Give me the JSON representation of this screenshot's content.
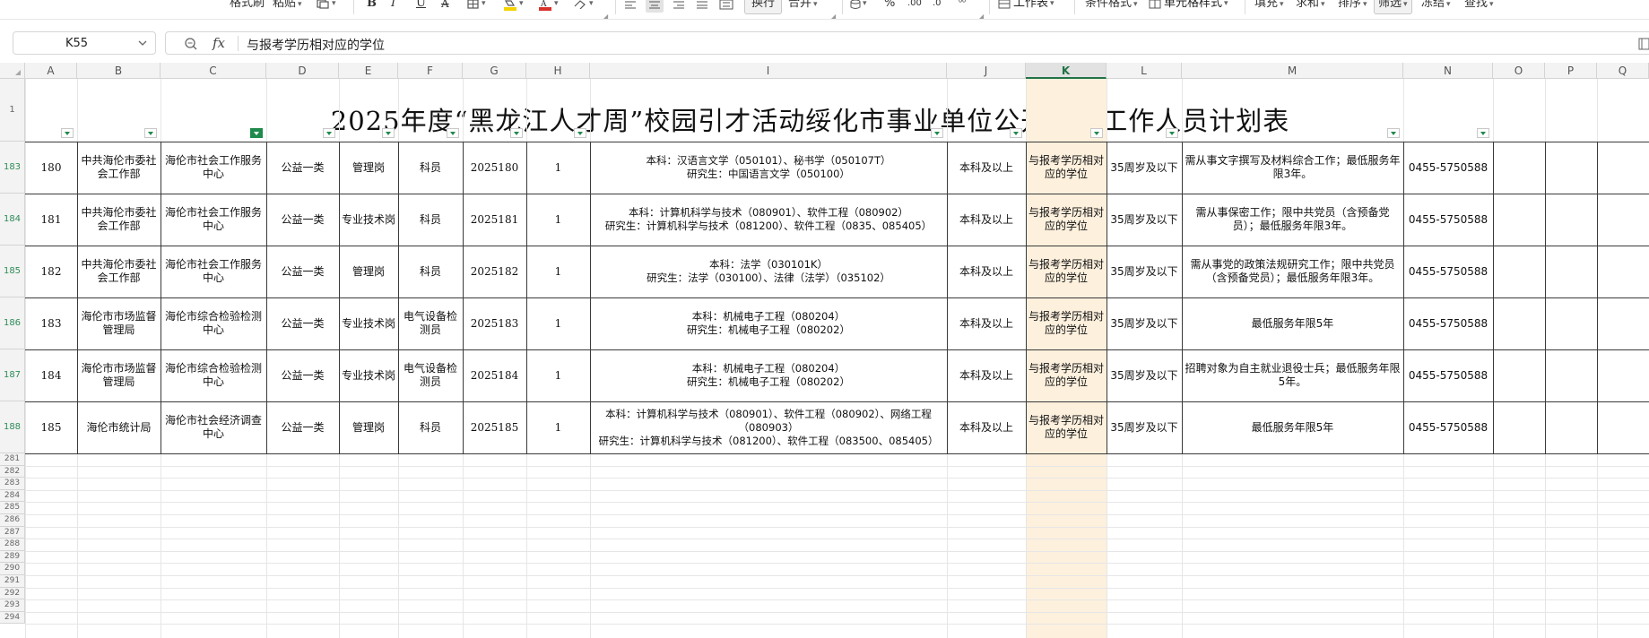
{
  "toolbar": {
    "format_painter": "格式刷",
    "paste": "粘贴",
    "bold": "B",
    "italic": "I",
    "underline": "U",
    "strikethrough": "A",
    "wrap": "换行",
    "merge": "合并",
    "percent": "%",
    "worksheet": "工作表",
    "conditional_format": "条件格式",
    "cell_style": "单元格样式",
    "fill": "填充",
    "sum": "求和",
    "sort": "排序",
    "filter": "筛选",
    "freeze": "冻结",
    "find": "查找"
  },
  "formula_bar": {
    "cell_ref": "K55",
    "fx": "fx",
    "content": "与报考学历相对应的学位"
  },
  "columns": [
    "A",
    "B",
    "C",
    "D",
    "E",
    "F",
    "G",
    "H",
    "I",
    "J",
    "K",
    "L",
    "M",
    "N",
    "O",
    "P",
    "Q"
  ],
  "selected_column": "K",
  "title": "2025年度“黑龙江人才周”校园引才活动绥化市事业单位公开招聘工作人员计划表",
  "rows": [
    {
      "row_num": "183",
      "seq": "180",
      "dept": "中共海伦市委社会工作部",
      "unit": "海伦市社会工作服务中心",
      "category": "公益一类",
      "post_type": "管理岗",
      "post_name": "科员",
      "code": "2025180",
      "count": "1",
      "major": "本科：汉语言文学（050101）、秘书学（050107T）\n研究生：中国语言文学（050100）",
      "education": "本科及以上",
      "degree": "与报考学历相对应的学位",
      "age": "35周岁及以下",
      "other": "需从事文字撰写及材料综合工作；最低服务年限3年。",
      "phone": "0455-5750588"
    },
    {
      "row_num": "184",
      "seq": "181",
      "dept": "中共海伦市委社会工作部",
      "unit": "海伦市社会工作服务中心",
      "category": "公益一类",
      "post_type": "专业技术岗",
      "post_name": "科员",
      "code": "2025181",
      "count": "1",
      "major": "本科：计算机科学与技术（080901）、软件工程（080902）\n研究生：计算机科学与技术（081200）、软件工程（0835、085405）",
      "education": "本科及以上",
      "degree": "与报考学历相对应的学位",
      "age": "35周岁及以下",
      "other": "需从事保密工作；限中共党员（含预备党员）；最低服务年限3年。",
      "phone": "0455-5750588"
    },
    {
      "row_num": "185",
      "seq": "182",
      "dept": "中共海伦市委社会工作部",
      "unit": "海伦市社会工作服务中心",
      "category": "公益一类",
      "post_type": "管理岗",
      "post_name": "科员",
      "code": "2025182",
      "count": "1",
      "major": "本科：法学（030101K）\n研究生：法学（030100）、法律（法学）（035102）",
      "education": "本科及以上",
      "degree": "与报考学历相对应的学位",
      "age": "35周岁及以下",
      "other": "需从事党的政策法规研究工作；限中共党员（含预备党员）；最低服务年限3年。",
      "phone": "0455-5750588"
    },
    {
      "row_num": "186",
      "seq": "183",
      "dept": "海伦市市场监督管理局",
      "unit": "海伦市综合检验检测中心",
      "category": "公益一类",
      "post_type": "专业技术岗",
      "post_name": "电气设备检测员",
      "code": "2025183",
      "count": "1",
      "major": "本科：机械电子工程（080204）\n研究生：机械电子工程（080202）",
      "education": "本科及以上",
      "degree": "与报考学历相对应的学位",
      "age": "35周岁及以下",
      "other": "最低服务年限5年",
      "phone": "0455-5750588"
    },
    {
      "row_num": "187",
      "seq": "184",
      "dept": "海伦市市场监督管理局",
      "unit": "海伦市综合检验检测中心",
      "category": "公益一类",
      "post_type": "专业技术岗",
      "post_name": "电气设备检测员",
      "code": "2025184",
      "count": "1",
      "major": "本科：机械电子工程（080204）\n研究生：机械电子工程（080202）",
      "education": "本科及以上",
      "degree": "与报考学历相对应的学位",
      "age": "35周岁及以下",
      "other": "招聘对象为自主就业退役士兵；最低服务年限5年。",
      "phone": "0455-5750588"
    },
    {
      "row_num": "188",
      "seq": "185",
      "dept": "海伦市统计局",
      "unit": "海伦市社会经济调查中心",
      "category": "公益一类",
      "post_type": "管理岗",
      "post_name": "科员",
      "code": "2025185",
      "count": "1",
      "major": "本科：计算机科学与技术（080901）、软件工程（080902）、网络工程（080903）\n研究生：计算机科学与技术（081200）、软件工程（083500、085405）",
      "education": "本科及以上",
      "degree": "与报考学历相对应的学位",
      "age": "35周岁及以下",
      "other": "最低服务年限5年",
      "phone": "0455-5750588"
    }
  ],
  "empty_rows": [
    "281",
    "282",
    "283",
    "284",
    "285",
    "286",
    "287",
    "288",
    "289",
    "290",
    "291",
    "292",
    "293",
    "294"
  ]
}
